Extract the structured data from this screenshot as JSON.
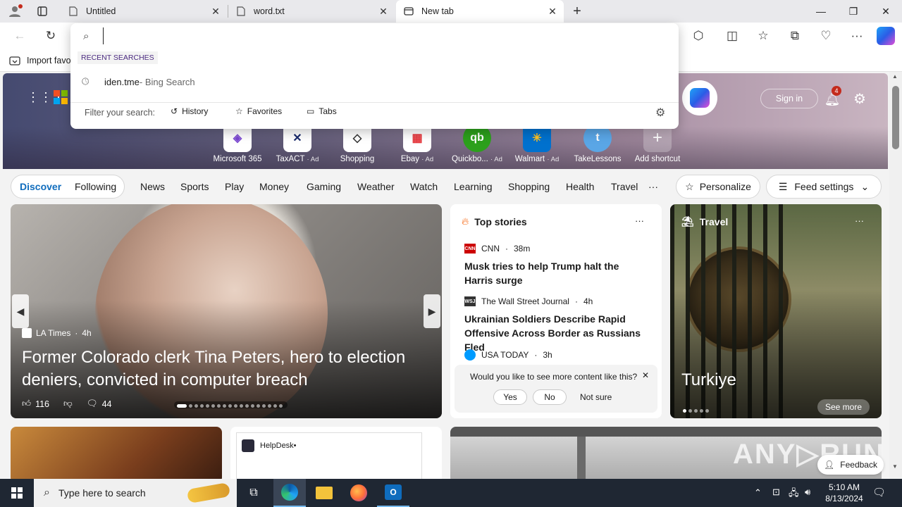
{
  "tabs": [
    {
      "label": "Untitled"
    },
    {
      "label": "word.txt"
    },
    {
      "label": "New tab"
    }
  ],
  "dropdown": {
    "input_value": "",
    "recent_heading": "RECENT SEARCHES",
    "recent_item": "iden.tme",
    "recent_suffix": " - Bing Search",
    "filter_label": "Filter your search:",
    "filters": [
      "History",
      "Favorites",
      "Tabs"
    ]
  },
  "favorites_bar": {
    "import_label": "Import favo"
  },
  "hero": {
    "signin": "Sign in",
    "notification_count": "4",
    "tiles": [
      {
        "label": "Microsoft 365",
        "ad": ""
      },
      {
        "label": "TaxACT",
        "ad": "· Ad"
      },
      {
        "label": "Shopping",
        "ad": ""
      },
      {
        "label": "Ebay",
        "ad": "· Ad"
      },
      {
        "label": "Quickbo...",
        "ad": "· Ad"
      },
      {
        "label": "Walmart",
        "ad": "· Ad"
      },
      {
        "label": "TakeLessons",
        "ad": ""
      },
      {
        "label": "Add shortcut",
        "ad": ""
      }
    ]
  },
  "nav": {
    "discover": "Discover",
    "following": "Following",
    "items": [
      "News",
      "Sports",
      "Play",
      "Money",
      "Gaming",
      "Weather",
      "Watch",
      "Learning",
      "Shopping",
      "Health",
      "Travel"
    ],
    "more": "···",
    "personalize": "Personalize",
    "feed_settings": "Feed settings"
  },
  "main_story": {
    "source": "LA Times",
    "age": "4h",
    "headline": "Former Colorado clerk Tina Peters, hero to election deniers, convicted in computer breach",
    "likes": "116",
    "comments": "44"
  },
  "top_stories": {
    "title": "Top stories",
    "more": "···",
    "items": [
      {
        "source": "CNN",
        "age": "38m",
        "headline": "Musk tries to help Trump halt the Harris surge"
      },
      {
        "source": "The Wall Street Journal",
        "age": "4h",
        "headline": "Ukrainian Soldiers Describe Rapid Offensive Across Border as Russians Fled"
      },
      {
        "source": "USA TODAY",
        "age": "3h",
        "headline": ""
      }
    ],
    "prompt": "Would you like to see more content like this?",
    "yes": "Yes",
    "no": "No",
    "not_sure": "Not sure"
  },
  "travel": {
    "title": "Travel",
    "more": "···",
    "headline": "Turkiye",
    "see_more": "See more"
  },
  "lower": {
    "helpdesk": "HelpDesk•"
  },
  "feedback": "Feedback",
  "taskbar": {
    "search_placeholder": "Type here to search",
    "time": "5:10 AM",
    "date": "8/13/2024"
  },
  "colors": {
    "accent": "#0f6cbd",
    "taskbar": "#1f2733",
    "notification_badge": "#c42b1c"
  }
}
